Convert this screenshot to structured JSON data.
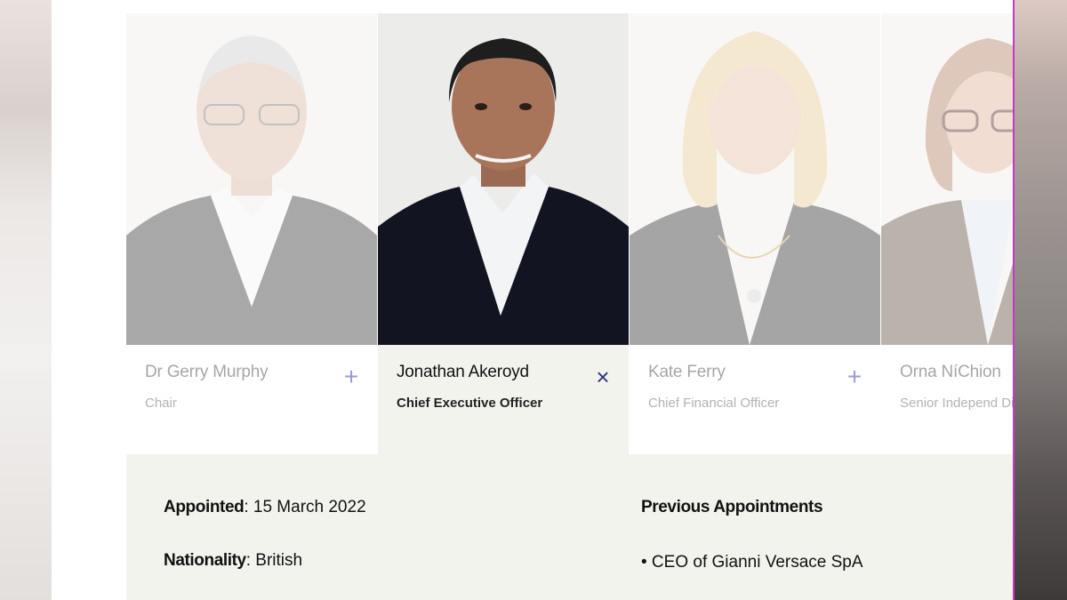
{
  "board": {
    "members": [
      {
        "name": "Dr Gerry Murphy",
        "role": "Chair",
        "toggle_icon": "plus-icon",
        "toggle_glyph": "+"
      },
      {
        "name": "Jonathan Akeroyd",
        "role": "Chief Executive Officer",
        "toggle_icon": "close-icon",
        "toggle_glyph": "×"
      },
      {
        "name": "Kate Ferry",
        "role": "Chief Financial Officer",
        "toggle_icon": "plus-icon",
        "toggle_glyph": "+"
      },
      {
        "name": "Orna NíChion",
        "role": "Senior Independ Director",
        "toggle_icon": "plus-icon",
        "toggle_glyph": "+"
      }
    ],
    "selected_index": 1
  },
  "details": {
    "appointed_label": "Appointed",
    "appointed_value": ": 15 March 2022",
    "nationality_label": "Nationality",
    "nationality_value": ": British",
    "previous_title": "Previous Appointments",
    "previous_items": [
      "• CEO of Gianni Versace SpA"
    ]
  },
  "colors": {
    "accent": "#2c2f8c",
    "panel_bg": "#f3f3ee",
    "frame_border": "#c43ac6"
  }
}
